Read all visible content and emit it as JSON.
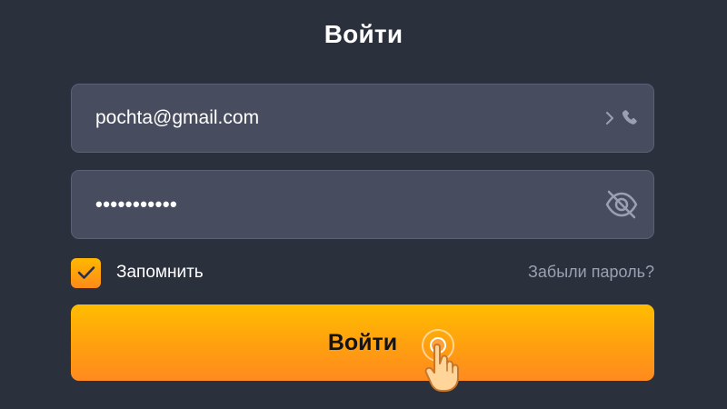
{
  "form": {
    "title": "Войти",
    "email": {
      "value": "pochta@gmail.com",
      "icon": "phone-icon",
      "switch_icon": "chevron-right-icon"
    },
    "password": {
      "masked_value": "•••••••••••",
      "icon": "eye-off-icon"
    },
    "remember": {
      "label": "Запомнить",
      "checked": true
    },
    "forgot_label": "Забыли пароль?",
    "submit_label": "Войти"
  },
  "colors": {
    "background": "#2b303d",
    "field_bg": "#474c5e",
    "accent_top": "#ffbd00",
    "accent_bottom": "#ff8a1f",
    "muted_text": "#9aa0b2"
  }
}
